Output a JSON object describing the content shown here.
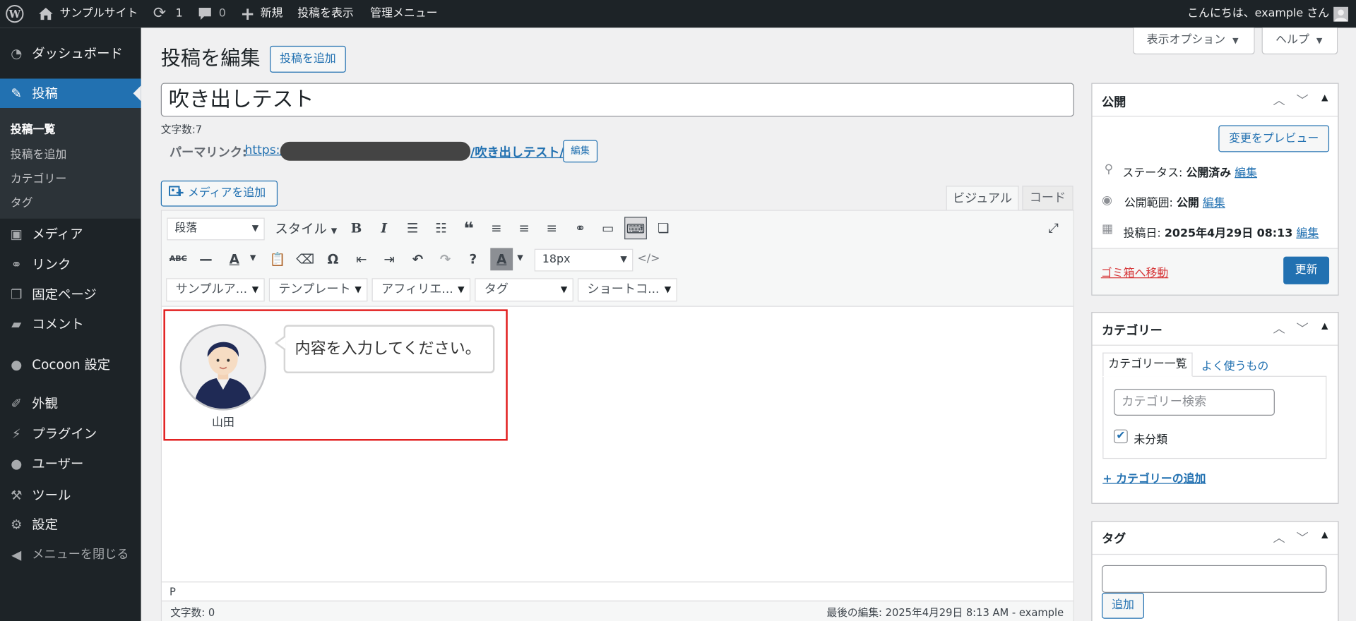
{
  "adminbar": {
    "site_name": "サンプルサイト",
    "updates_count": "1",
    "comments_count": "0",
    "new_label": "新規",
    "view_post": "投稿を表示",
    "admin_menu": "管理メニュー",
    "greeting": "こんにちは、example さん"
  },
  "sidebar": {
    "items": [
      {
        "label": "ダッシュボード",
        "icon": "dashboard-icon"
      },
      {
        "label": "投稿",
        "icon": "pin-icon"
      },
      {
        "label": "メディア",
        "icon": "media-icon"
      },
      {
        "label": "リンク",
        "icon": "link-icon"
      },
      {
        "label": "固定ページ",
        "icon": "page-icon"
      },
      {
        "label": "コメント",
        "icon": "comment-icon"
      },
      {
        "label": "Cocoon 設定",
        "icon": "cocoon-icon"
      },
      {
        "label": "外観",
        "icon": "appearance-icon"
      },
      {
        "label": "プラグイン",
        "icon": "plugin-icon"
      },
      {
        "label": "ユーザー",
        "icon": "user-icon"
      },
      {
        "label": "ツール",
        "icon": "wrench-icon"
      },
      {
        "label": "設定",
        "icon": "settings-icon"
      },
      {
        "label": "メニューを閉じる",
        "icon": "collapse-icon"
      }
    ],
    "submenu": [
      "投稿一覧",
      "投稿を追加",
      "カテゴリー",
      "タグ"
    ]
  },
  "screen_meta": {
    "display_options": "表示オプション",
    "help": "ヘルプ"
  },
  "page": {
    "heading": "投稿を編集",
    "add_new": "投稿を追加",
    "title_value": "吹き出しテスト",
    "char_count": "文字数:7",
    "permalink_label": "パーマリンク:",
    "permalink_prefix": "https://",
    "permalink_slug": "/吹き出しテスト/",
    "permalink_edit": "編集",
    "add_media": "メディアを追加",
    "tab_visual": "ビジュアル",
    "tab_code": "コード"
  },
  "toolbar": {
    "format_select": "段落",
    "styles_select": "スタイル",
    "font_size": "18px",
    "groups": [
      "サンプルア...",
      "テンプレート",
      "アフィリエ...",
      "タグ",
      "ショートコ..."
    ]
  },
  "editor": {
    "speaker_name": "山田",
    "bubble_text": "内容を入力してください。",
    "path": "P",
    "word_count": "文字数: 0",
    "last_edited": "最後の編集: 2025年4月29日 8:13 AM - example"
  },
  "publish": {
    "title": "公開",
    "preview": "変更をプレビュー",
    "status_label": "ステータス:",
    "status_value": "公開済み",
    "visibility_label": "公開範囲:",
    "visibility_value": "公開",
    "date_label": "投稿日:",
    "date_value": "2025年4月29日 08:13",
    "edit": "編集",
    "trash": "ゴミ箱へ移動",
    "update": "更新"
  },
  "categories": {
    "title": "カテゴリー",
    "tab_all": "カテゴリー一覧",
    "tab_popular": "よく使うもの",
    "search_placeholder": "カテゴリー検索",
    "items": [
      {
        "label": "未分類",
        "checked": true
      }
    ],
    "add_link": "+ カテゴリーの追加"
  },
  "tags": {
    "title": "タグ",
    "add_button": "追加"
  },
  "colors": {
    "admin_bg": "#1d2327",
    "accent": "#2271b1",
    "danger": "#d63638",
    "highlight_border": "#e11b1b"
  }
}
